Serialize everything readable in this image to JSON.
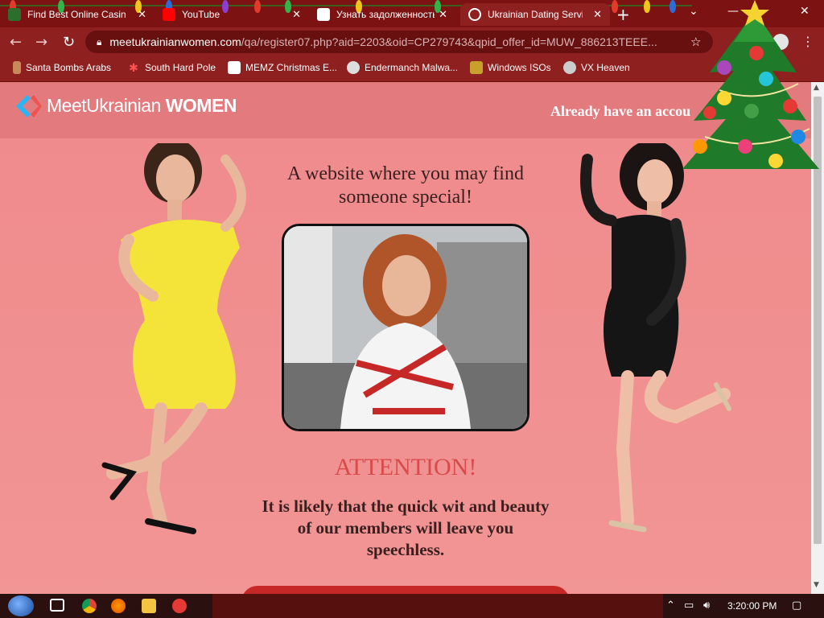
{
  "browser": {
    "tabs": [
      {
        "title": "Find Best Online Casino",
        "icon": "casino-favicon"
      },
      {
        "title": "YouTube",
        "icon": "youtube-favicon"
      },
      {
        "title": "Узнать задолженность",
        "icon": "site-favicon"
      },
      {
        "title": "Ukrainian Dating Services",
        "icon": "globe-favicon",
        "active": true
      }
    ],
    "url_host": "meetukrainianwomen.com",
    "url_path": "/qa/register07.php?aid=2203&oid=CP279743&qpid_offer_id=MUW_886213TEEE...",
    "bookmarks": [
      {
        "label": "Santa Bombs Arabs",
        "icon": "santa-icon"
      },
      {
        "label": "South Hard Pole",
        "icon": "snowflake-icon"
      },
      {
        "label": "MEMZ Christmas E...",
        "icon": "memz-icon"
      },
      {
        "label": "Endermanch Malwa...",
        "icon": "skull-icon"
      },
      {
        "label": "Windows ISOs",
        "icon": "windows-icon"
      },
      {
        "label": "VX Heaven",
        "icon": "vx-icon"
      }
    ],
    "colors": {
      "frame": "#7d1212",
      "toolbar": "#8e2020",
      "omnibox": "#681010"
    }
  },
  "site": {
    "logo_prefix": "MeetUkrainian",
    "logo_suffix": "WOMEN",
    "login_link": "Already have an accou",
    "tagline_line1": "A website where you may find",
    "tagline_line2": "someone special!",
    "attention": "ATTENTION!",
    "body_line1": "It is likely that the quick wit and beauty",
    "body_line2": "of our members will leave you",
    "body_line3": "speechless.",
    "colors": {
      "background": "#f08e8e",
      "attention": "#d94a4a",
      "text": "#3a1f1f",
      "cta": "#c62828"
    }
  },
  "taskbar": {
    "clock": "3:20:00 PM",
    "pinned": [
      "task-view-icon",
      "chrome-icon",
      "firefox-icon",
      "file-explorer-icon",
      "app-icon"
    ],
    "tray": [
      "chevron-up-icon",
      "network-icon",
      "volume-icon",
      "notification-icon"
    ]
  }
}
